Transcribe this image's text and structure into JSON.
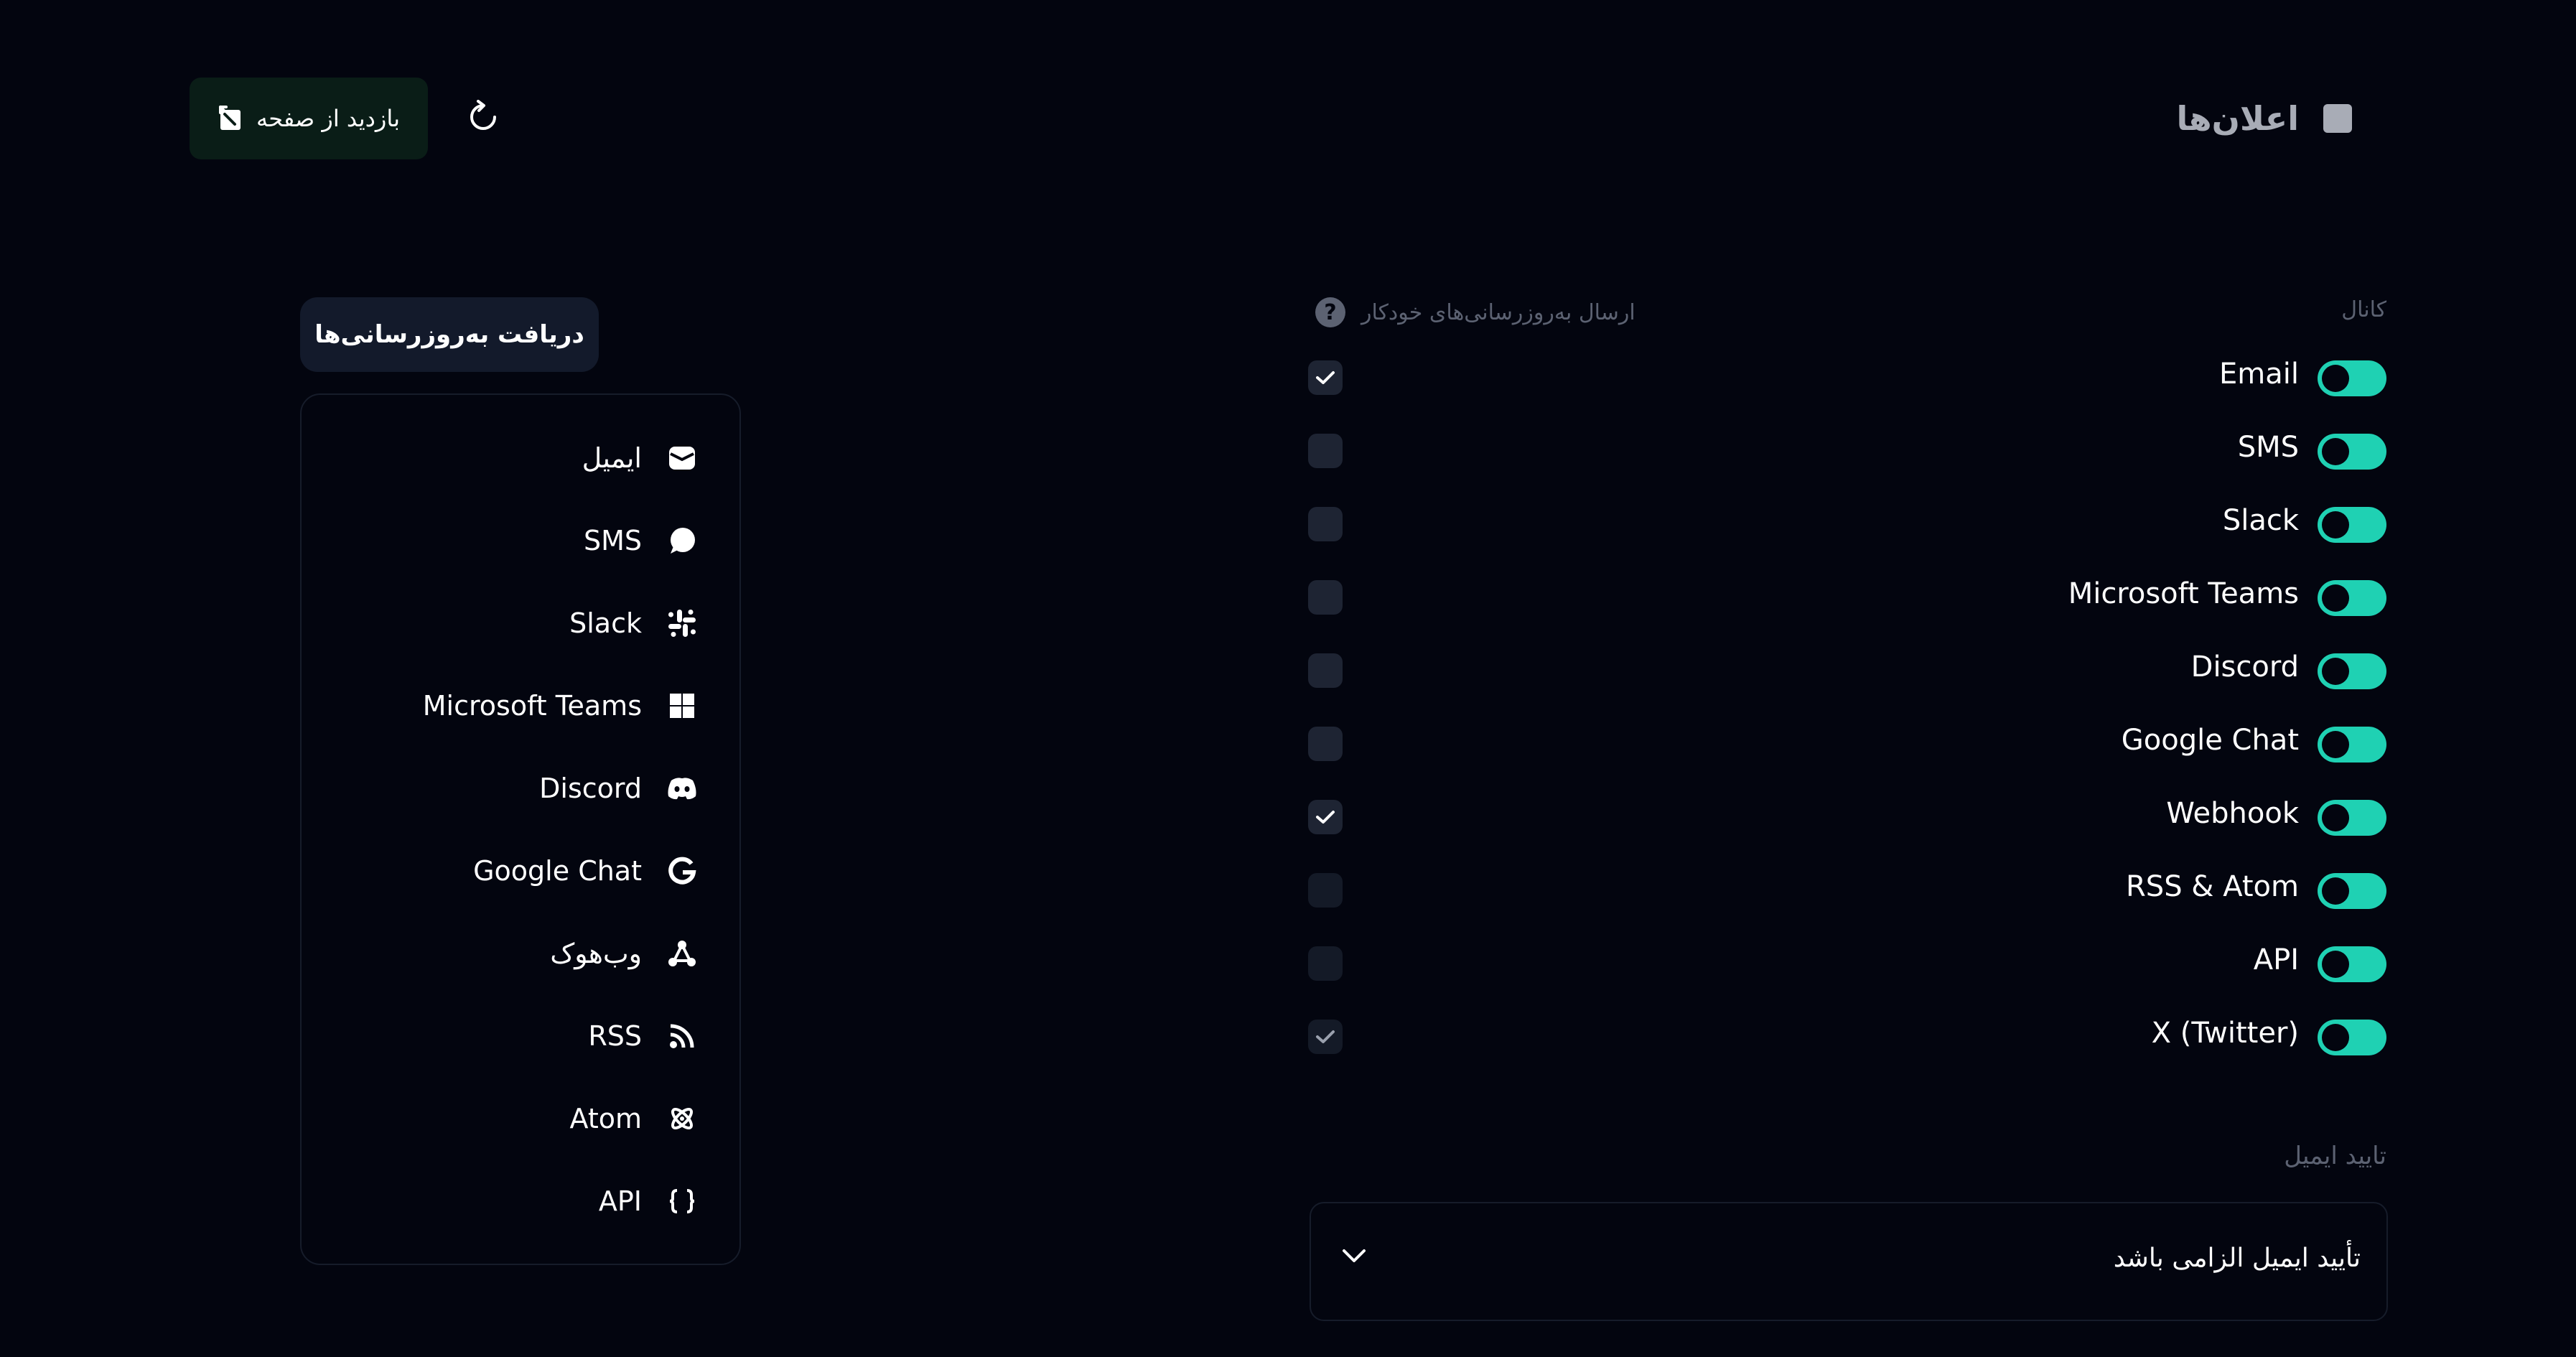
{
  "header": {
    "title": "اعلان‌ها",
    "visit_page_label": "بازدید از صفحه"
  },
  "receive_updates": {
    "title": "دریافت به‌روزرسانی‌ها",
    "items": [
      {
        "label": "ایمیل",
        "icon": "email-icon"
      },
      {
        "label": "SMS",
        "icon": "chat-bubble-icon"
      },
      {
        "label": "Slack",
        "icon": "slack-icon"
      },
      {
        "label": "Microsoft Teams",
        "icon": "windows-icon"
      },
      {
        "label": "Discord",
        "icon": "discord-icon"
      },
      {
        "label": "Google Chat",
        "icon": "google-icon"
      },
      {
        "label": "وب‌هوک",
        "icon": "webhook-icon"
      },
      {
        "label": "RSS",
        "icon": "rss-icon"
      },
      {
        "label": "Atom",
        "icon": "atom-icon"
      },
      {
        "label": "API",
        "icon": "braces-icon"
      }
    ]
  },
  "settings": {
    "channel_header": "کانال",
    "auto_send_header": "ارسال به‌روزرسانی‌های خودکار",
    "rows": [
      {
        "label": "Email",
        "enabled": true,
        "auto_send": true
      },
      {
        "label": "SMS",
        "enabled": true,
        "auto_send": false
      },
      {
        "label": "Slack",
        "enabled": true,
        "auto_send": false
      },
      {
        "label": "Microsoft Teams",
        "enabled": true,
        "auto_send": false
      },
      {
        "label": "Discord",
        "enabled": true,
        "auto_send": false
      },
      {
        "label": "Google Chat",
        "enabled": true,
        "auto_send": false
      },
      {
        "label": "Webhook",
        "enabled": true,
        "auto_send": true
      },
      {
        "label": "RSS & Atom",
        "enabled": true,
        "auto_send": false
      },
      {
        "label": "API",
        "enabled": true,
        "auto_send": false
      },
      {
        "label": "X (Twitter)",
        "enabled": true,
        "auto_send": true
      }
    ],
    "email_verification_label": "تایید ایمیل",
    "email_verification_value": "تأیید ایمیل الزامی باشد"
  },
  "colors": {
    "background": "#03050f",
    "accent_toggle": "#1fd1b3",
    "muted_text": "#5c6272",
    "visit_button_bg": "#0a1d17"
  }
}
